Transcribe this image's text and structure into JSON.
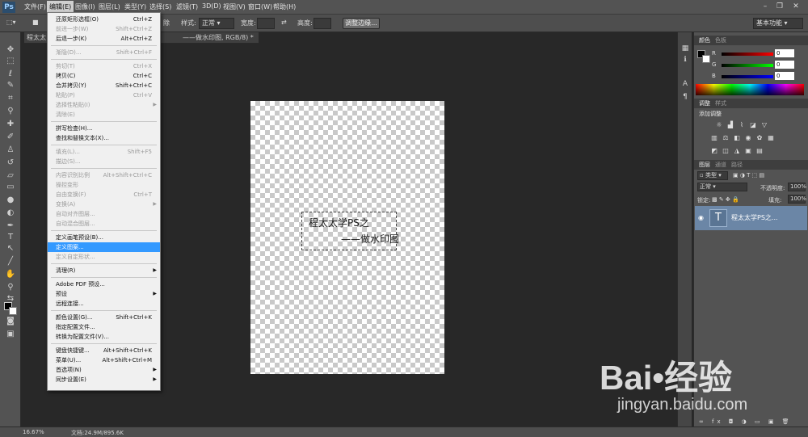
{
  "app": {
    "logo": "Ps"
  },
  "menubar": {
    "items": [
      "文件(F)",
      "编辑(E)",
      "图像(I)",
      "图层(L)",
      "类型(Y)",
      "选择(S)",
      "滤镜(T)",
      "3D(D)",
      "视图(V)",
      "窗口(W)",
      "帮助(H)"
    ],
    "active_index": 1,
    "window_controls": [
      "minimize",
      "restore",
      "close"
    ]
  },
  "options_bar": {
    "feather_suffix": "除",
    "style_label": "样式:",
    "style_value": "正常",
    "width_label": "宽度:",
    "height_label": "高度:",
    "refine_edge_button": "调整边缘...",
    "workspace": "基本功能"
  },
  "document": {
    "tab_title": "——做水印图, RGB/8) *"
  },
  "tab_left_text": "程太太",
  "watermark_text": {
    "line1": "程太太学PS之",
    "line2": "——做水印图"
  },
  "edit_menu": {
    "items": [
      {
        "label": "还原矩形选框(O)",
        "shortcut": "Ctrl+Z",
        "disabled": false
      },
      {
        "label": "前进一步(W)",
        "shortcut": "Shift+Ctrl+Z",
        "disabled": true
      },
      {
        "label": "后退一步(K)",
        "shortcut": "Alt+Ctrl+Z",
        "disabled": false
      },
      {
        "sep": true
      },
      {
        "label": "渐隐(D)...",
        "shortcut": "Shift+Ctrl+F",
        "disabled": true
      },
      {
        "sep": true
      },
      {
        "label": "剪切(T)",
        "shortcut": "Ctrl+X",
        "disabled": true
      },
      {
        "label": "拷贝(C)",
        "shortcut": "Ctrl+C",
        "disabled": false
      },
      {
        "label": "合并拷贝(Y)",
        "shortcut": "Shift+Ctrl+C",
        "disabled": false
      },
      {
        "label": "粘贴(P)",
        "shortcut": "Ctrl+V",
        "disabled": true
      },
      {
        "label": "选择性粘贴(I)",
        "shortcut": "",
        "disabled": true,
        "submenu": true
      },
      {
        "label": "清除(E)",
        "shortcut": "",
        "disabled": true
      },
      {
        "sep": true
      },
      {
        "label": "拼写检查(H)...",
        "shortcut": "",
        "disabled": false
      },
      {
        "label": "查找和替换文本(X)...",
        "shortcut": "",
        "disabled": false
      },
      {
        "sep": true
      },
      {
        "label": "填充(L)...",
        "shortcut": "Shift+F5",
        "disabled": true
      },
      {
        "label": "描边(S)...",
        "shortcut": "",
        "disabled": true
      },
      {
        "sep": true
      },
      {
        "label": "内容识别比例",
        "shortcut": "Alt+Shift+Ctrl+C",
        "disabled": true
      },
      {
        "label": "操控变形",
        "shortcut": "",
        "disabled": true
      },
      {
        "label": "自由变换(F)",
        "shortcut": "Ctrl+T",
        "disabled": true
      },
      {
        "label": "变换(A)",
        "shortcut": "",
        "disabled": true,
        "submenu": true
      },
      {
        "label": "自动对齐图层...",
        "shortcut": "",
        "disabled": true
      },
      {
        "label": "自动混合图层...",
        "shortcut": "",
        "disabled": true
      },
      {
        "sep": true
      },
      {
        "label": "定义画笔预设(B)...",
        "shortcut": "",
        "disabled": false
      },
      {
        "label": "定义图案...",
        "shortcut": "",
        "disabled": false,
        "highlighted": true
      },
      {
        "label": "定义自定形状...",
        "shortcut": "",
        "disabled": true
      },
      {
        "sep": true
      },
      {
        "label": "清理(R)",
        "shortcut": "",
        "disabled": false,
        "submenu": true
      },
      {
        "sep": true
      },
      {
        "label": "Adobe PDF 预设...",
        "shortcut": "",
        "disabled": false
      },
      {
        "label": "预设",
        "shortcut": "",
        "disabled": false,
        "submenu": true
      },
      {
        "label": "远程连接...",
        "shortcut": "",
        "disabled": false
      },
      {
        "sep": true
      },
      {
        "label": "颜色设置(G)...",
        "shortcut": "Shift+Ctrl+K",
        "disabled": false
      },
      {
        "label": "指定配置文件...",
        "shortcut": "",
        "disabled": false
      },
      {
        "label": "转换为配置文件(V)...",
        "shortcut": "",
        "disabled": false
      },
      {
        "sep": true
      },
      {
        "label": "键盘快捷键...",
        "shortcut": "Alt+Shift+Ctrl+K",
        "disabled": false
      },
      {
        "label": "菜单(U)...",
        "shortcut": "Alt+Shift+Ctrl+M",
        "disabled": false
      },
      {
        "label": "首选项(N)",
        "shortcut": "",
        "disabled": false,
        "submenu": true
      },
      {
        "label": "同步设置(E)",
        "shortcut": "",
        "disabled": false,
        "submenu": true
      }
    ]
  },
  "color_panel": {
    "tabs": [
      "颜色",
      "色板"
    ],
    "channels": [
      {
        "label": "R",
        "value": "0",
        "gradient": [
          "#000000",
          "#ff0000"
        ]
      },
      {
        "label": "G",
        "value": "0",
        "gradient": [
          "#000000",
          "#00ff00"
        ]
      },
      {
        "label": "B",
        "value": "0",
        "gradient": [
          "#000000",
          "#0000ff"
        ]
      }
    ]
  },
  "adjustments_panel": {
    "tabs": [
      "调整",
      "样式"
    ],
    "title": "添加调整"
  },
  "layers_panel": {
    "tabs": [
      "图层",
      "通道",
      "路径"
    ],
    "filter_kind": "类型",
    "blend_mode": "正常",
    "opacity_label": "不透明度:",
    "opacity_value": "100%",
    "lock_label": "锁定:",
    "fill_label": "填充:",
    "fill_value": "100%",
    "layers": [
      {
        "name": "程太太学PS之...",
        "type_glyph": "T",
        "visible": true,
        "selected": true
      }
    ]
  },
  "status_bar": {
    "zoom": "16.67%",
    "doc_info": "文档:24.9M/895.6K"
  },
  "watermark": {
    "brand_main": "Bai•经验",
    "brand_sub": "jingyan.baidu.com"
  },
  "colors": {
    "accent_highlight": "#3399ff",
    "selected_layer": "#6b86a6",
    "ui_dark": "#282828",
    "panel": "#535353"
  }
}
